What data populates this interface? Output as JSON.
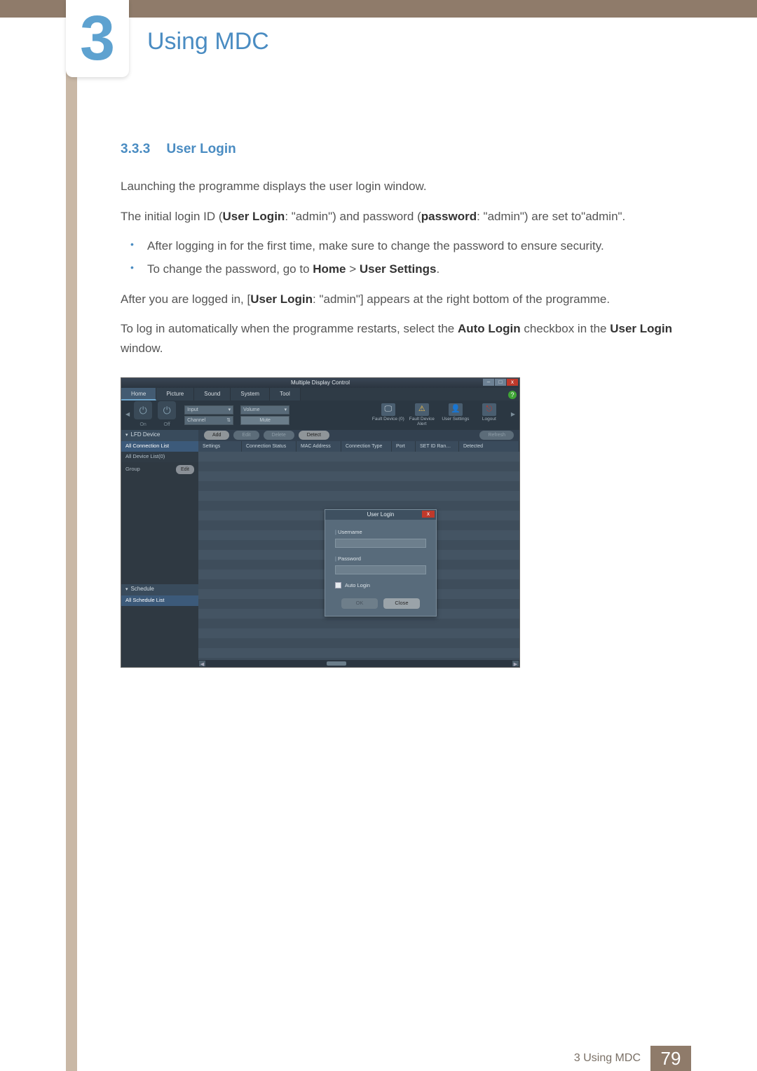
{
  "chapter": {
    "number": "3",
    "title": "Using MDC"
  },
  "section": {
    "number": "3.3.3",
    "title": "User Login"
  },
  "intro": "Launching the programme displays the user login window.",
  "initial_login_pre": "The initial login ID (",
  "initial_login_b1": "User Login",
  "initial_login_mid1": ": \"admin\") and password (",
  "initial_login_b2": "password",
  "initial_login_mid2": ": \"admin\") are set to\"admin\".",
  "bullets": [
    "After logging in for the first time, make sure to change the password to ensure security.",
    {
      "pre": "To change the password, go to ",
      "b1": "Home",
      "mid": " > ",
      "b2": "User Settings",
      "post": "."
    }
  ],
  "after_login_pre": "After you are logged in, [",
  "after_login_b": "User Login",
  "after_login_post": ": \"admin\"] appears at the right bottom of the programme.",
  "autologin_pre": "To log in automatically when the programme restarts, select the ",
  "autologin_b1": "Auto Login",
  "autologin_mid": " checkbox in the ",
  "autologin_b2": "User Login",
  "autologin_post": " window.",
  "app": {
    "title": "Multiple Display Control",
    "help": "?",
    "menu": [
      "Home",
      "Picture",
      "Sound",
      "System",
      "Tool"
    ],
    "toolbar": {
      "on": "On",
      "off": "Off",
      "input_label": "Input",
      "channel_label": "Channel",
      "volume_label": "Volume",
      "mute": "Mute",
      "icons": [
        {
          "lbl": "Fault Device (0)",
          "ico": "⚠"
        },
        {
          "lbl": "Fault Device Alert",
          "ico": "⚠"
        },
        {
          "lbl": "User Settings",
          "ico": "👤"
        },
        {
          "lbl": "Logout",
          "ico": "⤴"
        }
      ]
    },
    "sidebar": {
      "lfd": "LFD Device",
      "all_conn": "All Connection List",
      "all_dev": "All Device List(0)",
      "group": "Group",
      "edit": "Edit",
      "schedule": "Schedule",
      "all_sched": "All Schedule List"
    },
    "actions": {
      "add": "Add",
      "edit": "Edit",
      "delete": "Delete",
      "detect": "Detect",
      "refresh": "Refresh"
    },
    "cols": [
      "Settings",
      "Connection Status",
      "MAC Address",
      "Connection Type",
      "Port",
      "SET ID Ran…",
      "Detected"
    ],
    "dialog": {
      "title": "User Login",
      "username": "Username",
      "password": "Password",
      "auto": "Auto Login",
      "ok": "OK",
      "close": "Close"
    }
  },
  "footer": {
    "label": "3 Using MDC",
    "page": "79"
  }
}
